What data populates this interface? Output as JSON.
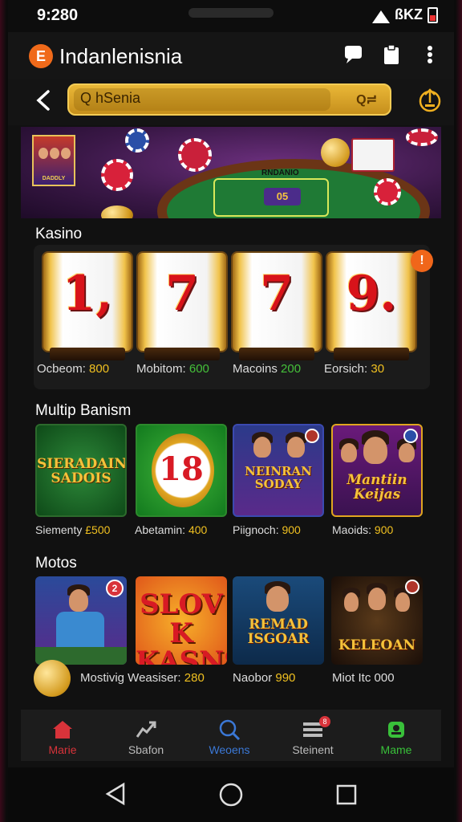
{
  "status_bar": {
    "time": "9:280",
    "right_text": "ßKZ"
  },
  "app_bar": {
    "logo_letter": "E",
    "title": "Indanlenisnia"
  },
  "search": {
    "label": "Q hSenia",
    "right_icon_text": "Q≓"
  },
  "banner": {
    "table_label": "RNDANIO",
    "table_number": "05",
    "thumb_text": "DADDLY"
  },
  "sections": {
    "kasino": {
      "title": "Kasino",
      "badge": "!",
      "reels": [
        {
          "symbol": "1,",
          "caption_label": "Ocbeom:",
          "caption_value": "800"
        },
        {
          "symbol": "7",
          "caption_label": "Mobitom:",
          "caption_value": "600"
        },
        {
          "symbol": "7",
          "caption_label": "Macoins",
          "caption_value": "200"
        },
        {
          "symbol": "9.",
          "caption_label": "Eorsich:",
          "caption_value": "30"
        }
      ]
    },
    "multip": {
      "title": "Multip Banism",
      "cards": [
        {
          "title": "SIERADAIN SADOIS",
          "caption_label": "Siementy",
          "caption_value": "£500"
        },
        {
          "title": "18",
          "caption_label": "Abetamin:",
          "caption_value": "400"
        },
        {
          "title": "NEINRAN SODAY",
          "caption_label": "Piignoch:",
          "caption_value": "900"
        },
        {
          "title": "Mantiin Keijas",
          "caption_label": "Maoids:",
          "caption_value": "900"
        }
      ]
    },
    "motos": {
      "title": "Motos",
      "cards": [
        {
          "title": "",
          "badge": "2"
        },
        {
          "title": "SLOV K KASNS"
        },
        {
          "title": "REMAD ISGOAR"
        },
        {
          "title": "KELEOAN"
        }
      ],
      "caption_1_label": "Mostivig Weasiser:",
      "caption_1_value": "280",
      "caption_2_label": "Naobor",
      "caption_2_value": "990",
      "caption_3_label": "Miot Itc",
      "caption_3_value": "000"
    }
  },
  "bottom_nav": [
    {
      "label": "Marie",
      "color": "#d8333a",
      "icon": "home-icon"
    },
    {
      "label": "Sbafon",
      "color": "#bbbbbb",
      "icon": "chart-icon"
    },
    {
      "label": "Weoens",
      "color": "#3b78d6",
      "icon": "search-icon"
    },
    {
      "label": "Steinent",
      "color": "#bbbbbb",
      "icon": "list-icon",
      "badge": "8"
    },
    {
      "label": "Mame",
      "color": "#39c03a",
      "icon": "profile-icon"
    }
  ],
  "colors": {
    "accent_gold": "#f0c020",
    "accent_green": "#45c03a",
    "brand_orange": "#f06a1a"
  }
}
